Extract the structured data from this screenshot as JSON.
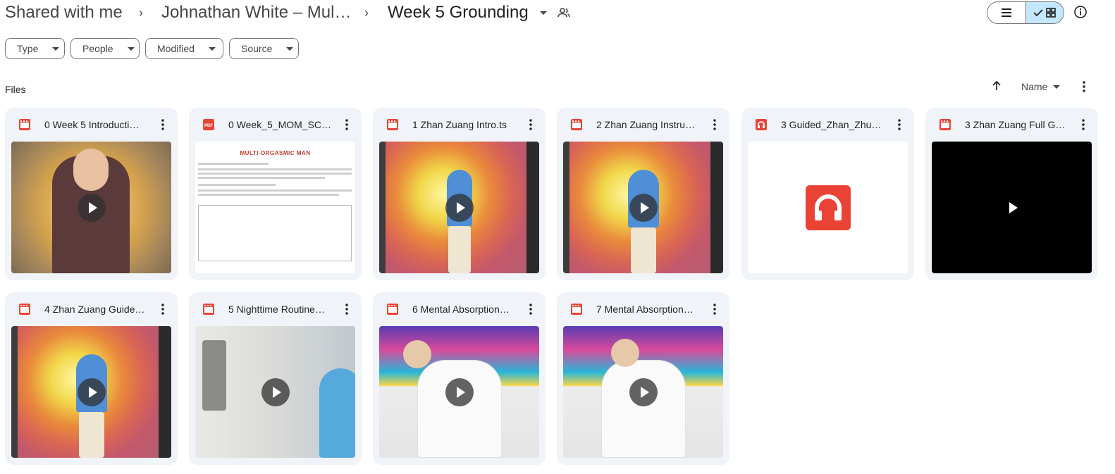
{
  "breadcrumb": {
    "items": [
      "Shared with me",
      "Johnathan White – Mul…",
      "Week 5 Grounding"
    ],
    "separator": "›"
  },
  "icons": {
    "shared": "people-icon",
    "list_view": "list-icon",
    "grid_view": "grid-icon",
    "check": "check-icon",
    "info": "info-icon",
    "sort": "arrow-up-icon",
    "more": "more-vert-icon"
  },
  "filters": [
    "Type",
    "People",
    "Modified",
    "Source"
  ],
  "section_label": "Files",
  "sort": {
    "label": "Name",
    "direction": "ascending"
  },
  "colors": {
    "video_icon": "#ea4335",
    "pdf_icon": "#ea4335",
    "audio_icon": "#ea4335",
    "selected_view": "#c2e7ff",
    "card_bg": "#f0f4f9"
  },
  "files": [
    {
      "name": "0 Week 5 Introducti…",
      "type": "video",
      "thumb": "portrait"
    },
    {
      "name": "0 Week_5_MOM_SC…",
      "type": "pdf",
      "thumb": "document",
      "doc_title": "MULTI-ORGASMIC MAN"
    },
    {
      "name": "1 Zhan Zuang Intro.ts",
      "type": "video",
      "thumb": "standing"
    },
    {
      "name": "2 Zhan Zuang Instru…",
      "type": "video",
      "thumb": "standing"
    },
    {
      "name": "3 Guided_Zhan_Zhu…",
      "type": "audio",
      "thumb": "audio"
    },
    {
      "name": "3 Zhan Zuang Full G…",
      "type": "video",
      "thumb": "black"
    },
    {
      "name": "4 Zhan Zuang Guide…",
      "type": "video",
      "thumb": "standing"
    },
    {
      "name": "5 Nighttime Routine…",
      "type": "video",
      "thumb": "nighttime"
    },
    {
      "name": "6 Mental Absorption…",
      "type": "video",
      "thumb": "seated"
    },
    {
      "name": "7 Mental Absorption…",
      "type": "video",
      "thumb": "seated"
    }
  ]
}
